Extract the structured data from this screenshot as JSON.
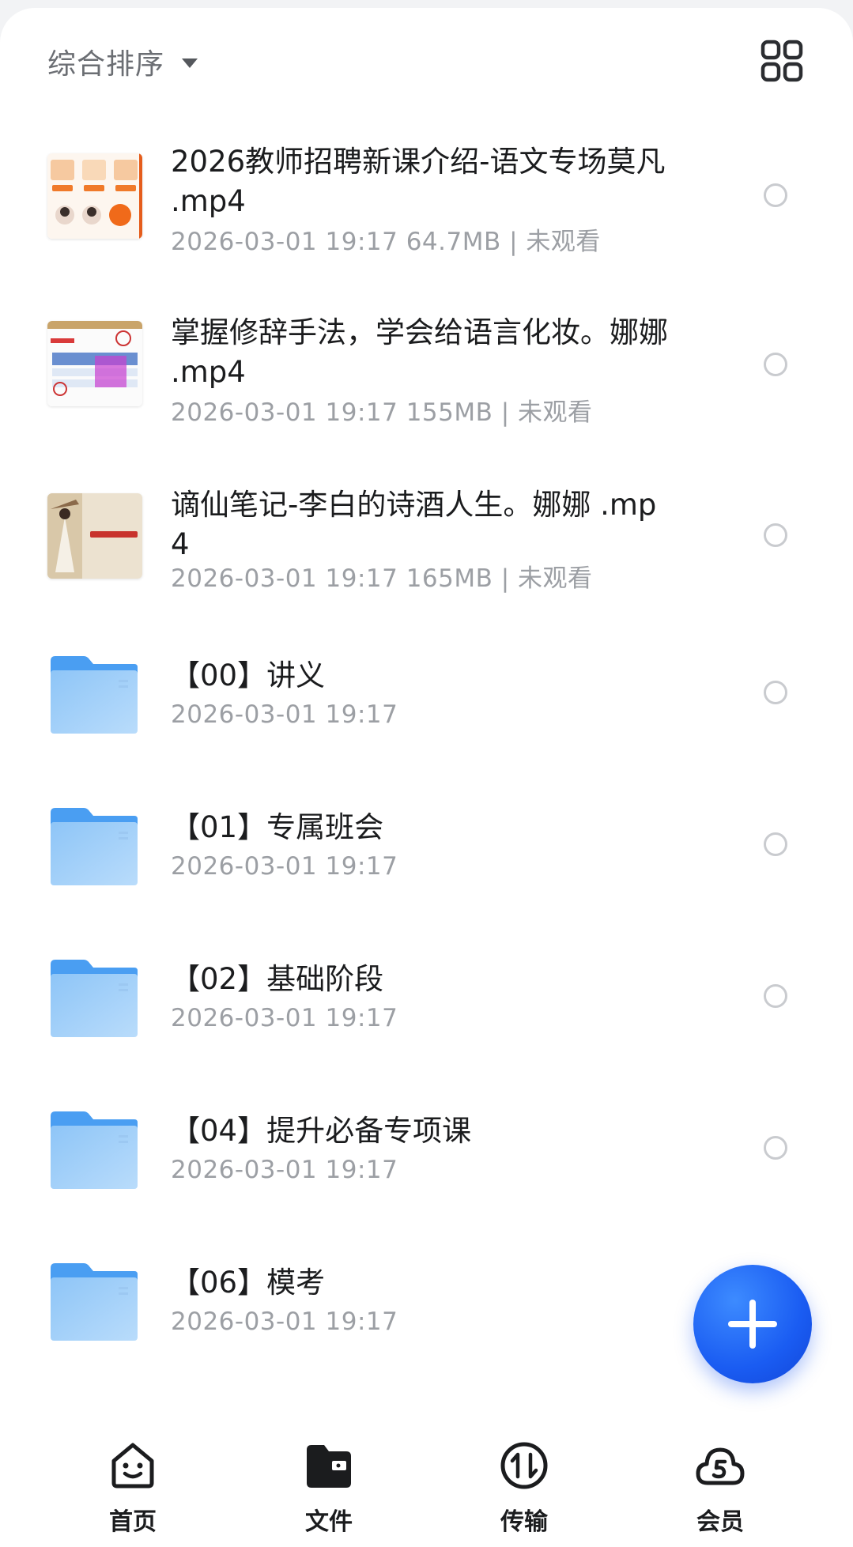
{
  "toolbar": {
    "sort_label": "综合排序",
    "sort_icon": "caret-down-icon",
    "view_toggle_icon": "grid-view-icon"
  },
  "files": [
    {
      "kind": "video",
      "title": "2026教师招聘新课介绍-语文专场莫凡 .mp4",
      "meta": "2026-03-01 19:17  64.7MB | 未观看",
      "thumb_icon": "video-thumbnail"
    },
    {
      "kind": "video",
      "title": "掌握修辞手法，学会给语言化妆。娜娜 .mp4",
      "meta": "2026-03-01 19:17  155MB | 未观看",
      "thumb_icon": "video-thumbnail"
    },
    {
      "kind": "video",
      "title": "谪仙笔记-李白的诗酒人生。娜娜 .mp4",
      "meta": "2026-03-01 19:17  165MB | 未观看",
      "thumb_icon": "video-thumbnail"
    },
    {
      "kind": "folder",
      "title": "【00】讲义",
      "meta": "2026-03-01 19:17",
      "thumb_icon": "folder-icon"
    },
    {
      "kind": "folder",
      "title": "【01】专属班会",
      "meta": "2026-03-01 19:17",
      "thumb_icon": "folder-icon"
    },
    {
      "kind": "folder",
      "title": "【02】基础阶段",
      "meta": "2026-03-01 19:17",
      "thumb_icon": "folder-icon"
    },
    {
      "kind": "folder",
      "title": "【04】提升必备专项课",
      "meta": "2026-03-01 19:17",
      "thumb_icon": "folder-icon"
    },
    {
      "kind": "folder",
      "title": "【06】模考",
      "meta": "2026-03-01 19:17",
      "thumb_icon": "folder-icon"
    }
  ],
  "fab": {
    "icon": "plus-icon"
  },
  "tabs": [
    {
      "label": "首页",
      "icon": "smiley-home-icon"
    },
    {
      "label": "文件",
      "icon": "folder-filled-icon",
      "active": true
    },
    {
      "label": "传输",
      "icon": "transfer-arrows-icon"
    },
    {
      "label": "会员",
      "icon": "cloud-member-icon"
    }
  ],
  "colors": {
    "accent": "#1a5cf2",
    "folder": "#7cb8f5",
    "text_primary": "#1b1c1e",
    "text_secondary": "#9c9fa4"
  }
}
